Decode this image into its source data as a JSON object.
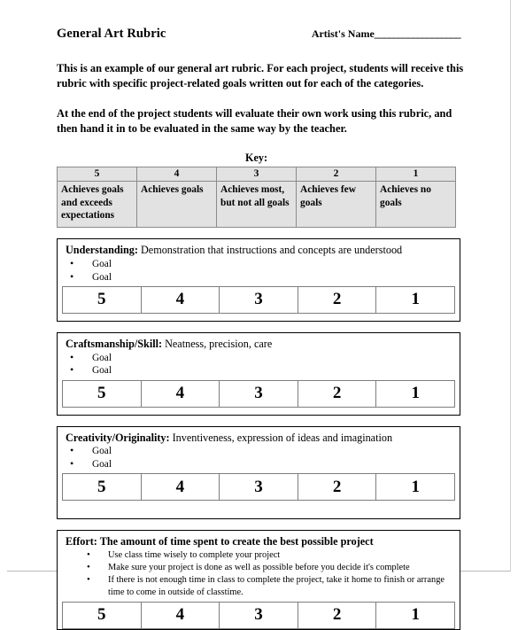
{
  "document": {
    "title": "General Art Rubric",
    "artist_label": "Artist's  Name",
    "artist_rule": "__________________",
    "intro_paragraph_1": "This is an example of our general art rubric. For each project, students will receive this rubric with specific project-related goals written out for each of the categories.",
    "intro_paragraph_2": "At the end of the project students will evaluate their own work using this rubric, and then hand it in to be evaluated in the same way by the teacher."
  },
  "key": {
    "label": "Key:",
    "scores": [
      "5",
      "4",
      "3",
      "2",
      "1"
    ],
    "descriptions": [
      "Achieves goals and exceeds expectations",
      "Achieves goals",
      "Achieves most, but not all goals",
      "Achieves few goals",
      "Achieves no goals"
    ]
  },
  "criteria": [
    {
      "name": "Understanding:",
      "description": "Demonstration that instructions and concepts are understood",
      "title_all_bold": false,
      "bullets": [
        "Goal",
        "Goal"
      ],
      "bullets_deep": false,
      "scores": [
        "5",
        "4",
        "3",
        "2",
        "1"
      ]
    },
    {
      "name": "Craftsmanship/Skill:",
      "description": "Neatness, precision, care",
      "title_all_bold": false,
      "bullets": [
        "Goal",
        "Goal"
      ],
      "bullets_deep": false,
      "scores": [
        "5",
        "4",
        "3",
        "2",
        "1"
      ]
    },
    {
      "name": "Creativity/Originality:",
      "description": "Inventiveness, expression of ideas and imagination",
      "title_all_bold": false,
      "bullets": [
        "Goal",
        "Goal"
      ],
      "bullets_deep": false,
      "scores": [
        "5",
        "4",
        "3",
        "2",
        "1"
      ]
    },
    {
      "name": "Effort: The amount of time spent to create the best possible project",
      "description": "",
      "title_all_bold": true,
      "bullets": [
        "Use class time wisely to complete your project",
        "Make sure your project is done as well as possible before you decide it's complete",
        "If there is not enough time in class to complete the project, take it home to finish or arrange time to come in outside of classtime."
      ],
      "bullets_deep": true,
      "scores": [
        "5",
        "4",
        "3",
        "2",
        "1"
      ]
    }
  ],
  "colors": {
    "key_header_fill": "#e2e2e2",
    "border": "#000000",
    "text": "#000000"
  }
}
